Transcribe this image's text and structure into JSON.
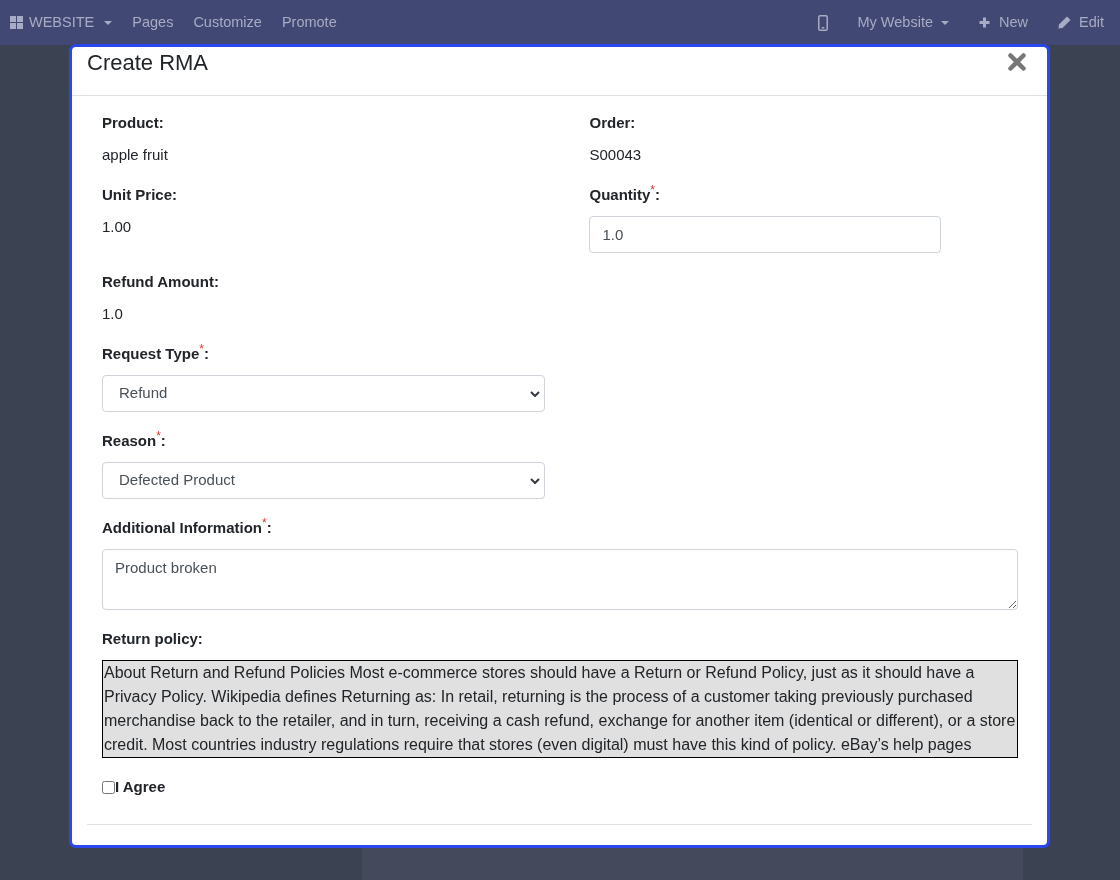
{
  "navbar": {
    "left": [
      {
        "kind": "apps",
        "label": "WEBSITE"
      },
      {
        "kind": "link",
        "label": "Pages"
      },
      {
        "kind": "link",
        "label": "Customize"
      },
      {
        "kind": "link",
        "label": "Promote"
      }
    ],
    "right": [
      {
        "kind": "mobile"
      },
      {
        "kind": "dropdown",
        "label": "My Website"
      },
      {
        "kind": "new",
        "label": "New"
      },
      {
        "kind": "edit",
        "label": "Edit"
      }
    ]
  },
  "dialog": {
    "title": "Create RMA",
    "rows": [
      [
        {
          "kind": "text",
          "label": "Product:",
          "value": "apple fruit"
        },
        {
          "kind": "text",
          "label": "Order:",
          "value": "S00043"
        }
      ],
      [
        {
          "kind": "text",
          "label": "Unit Price:",
          "value": "1.00"
        },
        {
          "kind": "input",
          "label": "Quantity$^{*}$:",
          "value": "1.0"
        }
      ],
      [
        {
          "kind": "text",
          "label": "Refund Amount:",
          "value": "1.0"
        }
      ],
      [
        {
          "kind": "select",
          "label": "Request Type$^{*}$:",
          "value": "Refund"
        }
      ],
      [
        {
          "kind": "select",
          "label": "Reason$^{*}$:",
          "value": "Defected Product"
        }
      ],
      [
        {
          "kind": "textarea",
          "label": "Additional Information$^{*}$:",
          "value": "Product broken"
        }
      ],
      [
        {
          "kind": "policy",
          "label": "Return policy:",
          "value": "About Return and Refund Policies Most e-commerce stores should have a Return or Refund Policy, just as it should have a Privacy Policy. Wikipedia defines Returning as: In retail, returning is the process of a customer taking previously purchased merchandise back to the retailer, and in turn, receiving a cash refund, exchange for another item (identical or different), or a store credit. Most countries industry regulations require that stores (even digital) must have this kind of policy. eBay’s help pages"
        }
      ]
    ],
    "agree": {
      "label": "I Agree",
      "checked": false
    }
  }
}
